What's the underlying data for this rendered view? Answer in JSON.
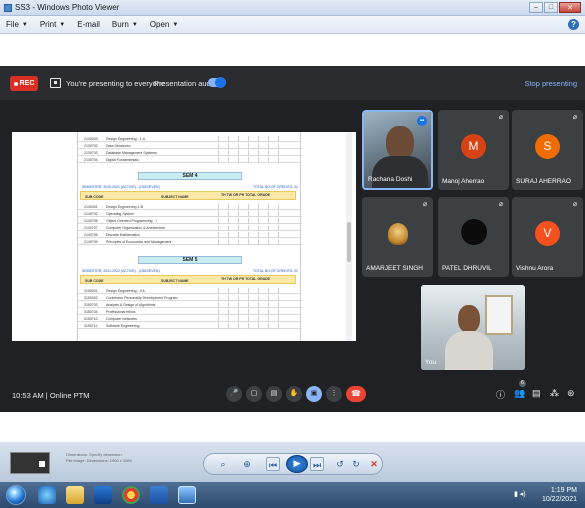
{
  "window": {
    "title": "SS3 - Windows Photo Viewer",
    "buttons": {
      "minimize": "–",
      "maximize": "□",
      "close": "✕"
    }
  },
  "menubar": {
    "items": [
      {
        "label": "File"
      },
      {
        "label": "Print"
      },
      {
        "label": "E-mail"
      },
      {
        "label": "Burn"
      },
      {
        "label": "Open"
      }
    ],
    "help_icon": "?"
  },
  "meet": {
    "rec_label": "REC",
    "presenting_text": "You're presenting to everyone",
    "presentation_audio": "Presentation audio",
    "stop_presenting": "Stop presenting",
    "meeting_time": "10:53 AM",
    "meeting_sep": "|",
    "meeting_name": "Online PTM",
    "participants": [
      {
        "name": "Rachana Doshi",
        "type": "video",
        "speaking": true
      },
      {
        "name": "Manoj Aherrao",
        "type": "initial",
        "initial": "M",
        "color": "#d84315"
      },
      {
        "name": "SURAJ AHERRAO",
        "type": "initial",
        "initial": "S",
        "color": "#ef6c00"
      },
      {
        "name": "AMARJEET SINGH",
        "type": "image",
        "muted": true
      },
      {
        "name": "PATEL DHRUVIL",
        "type": "image",
        "muted": true
      },
      {
        "name": "Vishnu Arora",
        "type": "initial",
        "initial": "V",
        "color": "#f4511e"
      }
    ],
    "self_label": "You",
    "mic_off_glyph": "⌀",
    "controls": [
      {
        "name": "mic-icon",
        "glyph": "🎤"
      },
      {
        "name": "camera-icon",
        "glyph": "▢"
      },
      {
        "name": "captions-icon",
        "glyph": "▤"
      },
      {
        "name": "raise-hand-icon",
        "glyph": "✋"
      },
      {
        "name": "present-icon",
        "glyph": "▣"
      },
      {
        "name": "more-options-icon",
        "glyph": "⋮"
      }
    ],
    "end_call_glyph": "☎",
    "right_controls": [
      {
        "name": "info-icon",
        "glyph": "ⓘ"
      },
      {
        "name": "people-icon",
        "glyph": "👥"
      },
      {
        "name": "chat-icon",
        "glyph": "▤"
      },
      {
        "name": "activities-icon",
        "glyph": "⁂"
      },
      {
        "name": "lock-icon",
        "glyph": "⊛"
      }
    ],
    "people_count": "6"
  },
  "document": {
    "sem4_label": "SEM 4",
    "sem5_label": "SEM 5",
    "sem4_left": "SEMESTER: 2020-2021 (ACTIVE) - (ODD/EVEN)",
    "sem4_right": "TOTAL NO.OF CREDITS: 22",
    "sem5_left": "SEMESTER: 2021-2022 (ACTIVE) - (ODD/EVEN)",
    "sem5_right": "TOTAL NO.OF CREDITS: 22",
    "col_code": "SUB CODE",
    "col_name": "SUBJECT NAME",
    "col_marks": "TH TW OR PR TOTAL GRADE",
    "top_rows": [
      {
        "code": "2130003",
        "name": "Design Engineering - 1-A"
      },
      {
        "code": "2130702",
        "name": "Data Structures"
      },
      {
        "code": "2130703",
        "name": "Database Management Systems"
      },
      {
        "code": "2130704",
        "name": "Digital Fundamentals"
      }
    ],
    "sem4_rows": [
      {
        "code": "2140001",
        "name": "Design Engineering 1-B"
      },
      {
        "code": "2140702",
        "name": "Operating System"
      },
      {
        "code": "2140705",
        "name": "Object Oriented Programming - I"
      },
      {
        "code": "2140707",
        "name": "Computer Organization & Architecture"
      },
      {
        "code": "2140706",
        "name": "Discrete Mathematics"
      },
      {
        "code": "2140709",
        "name": "Principles of Economics and Management"
      }
    ],
    "sem5_rows": [
      {
        "code": "3150001",
        "name": "Design Engineering - II A"
      },
      {
        "code": "3150002",
        "name": "Contributor Personality Development Program"
      },
      {
        "code": "3150703",
        "name": "Analysis & Design of Algorithms"
      },
      {
        "code": "3150704",
        "name": "Professional ethics"
      },
      {
        "code": "3150710",
        "name": "Computer Networks"
      },
      {
        "code": "3150711",
        "name": "Software Engineering"
      }
    ]
  },
  "viewer_controls": {
    "thumb_lines": [
      "Dimensions: Specify dimension",
      "File image: Dimensions: 1900 x 1080"
    ],
    "zoom": "⌕",
    "fit": "⊕",
    "prev": "⏮",
    "slideshow": "▶",
    "next": "⏭",
    "rotate_ccw": "↺",
    "rotate_cw": "↻",
    "delete": "✕"
  },
  "taskbar": {
    "time": "1:19 PM",
    "date": "10/22/2021",
    "tray_text": "▮ ◂)"
  }
}
